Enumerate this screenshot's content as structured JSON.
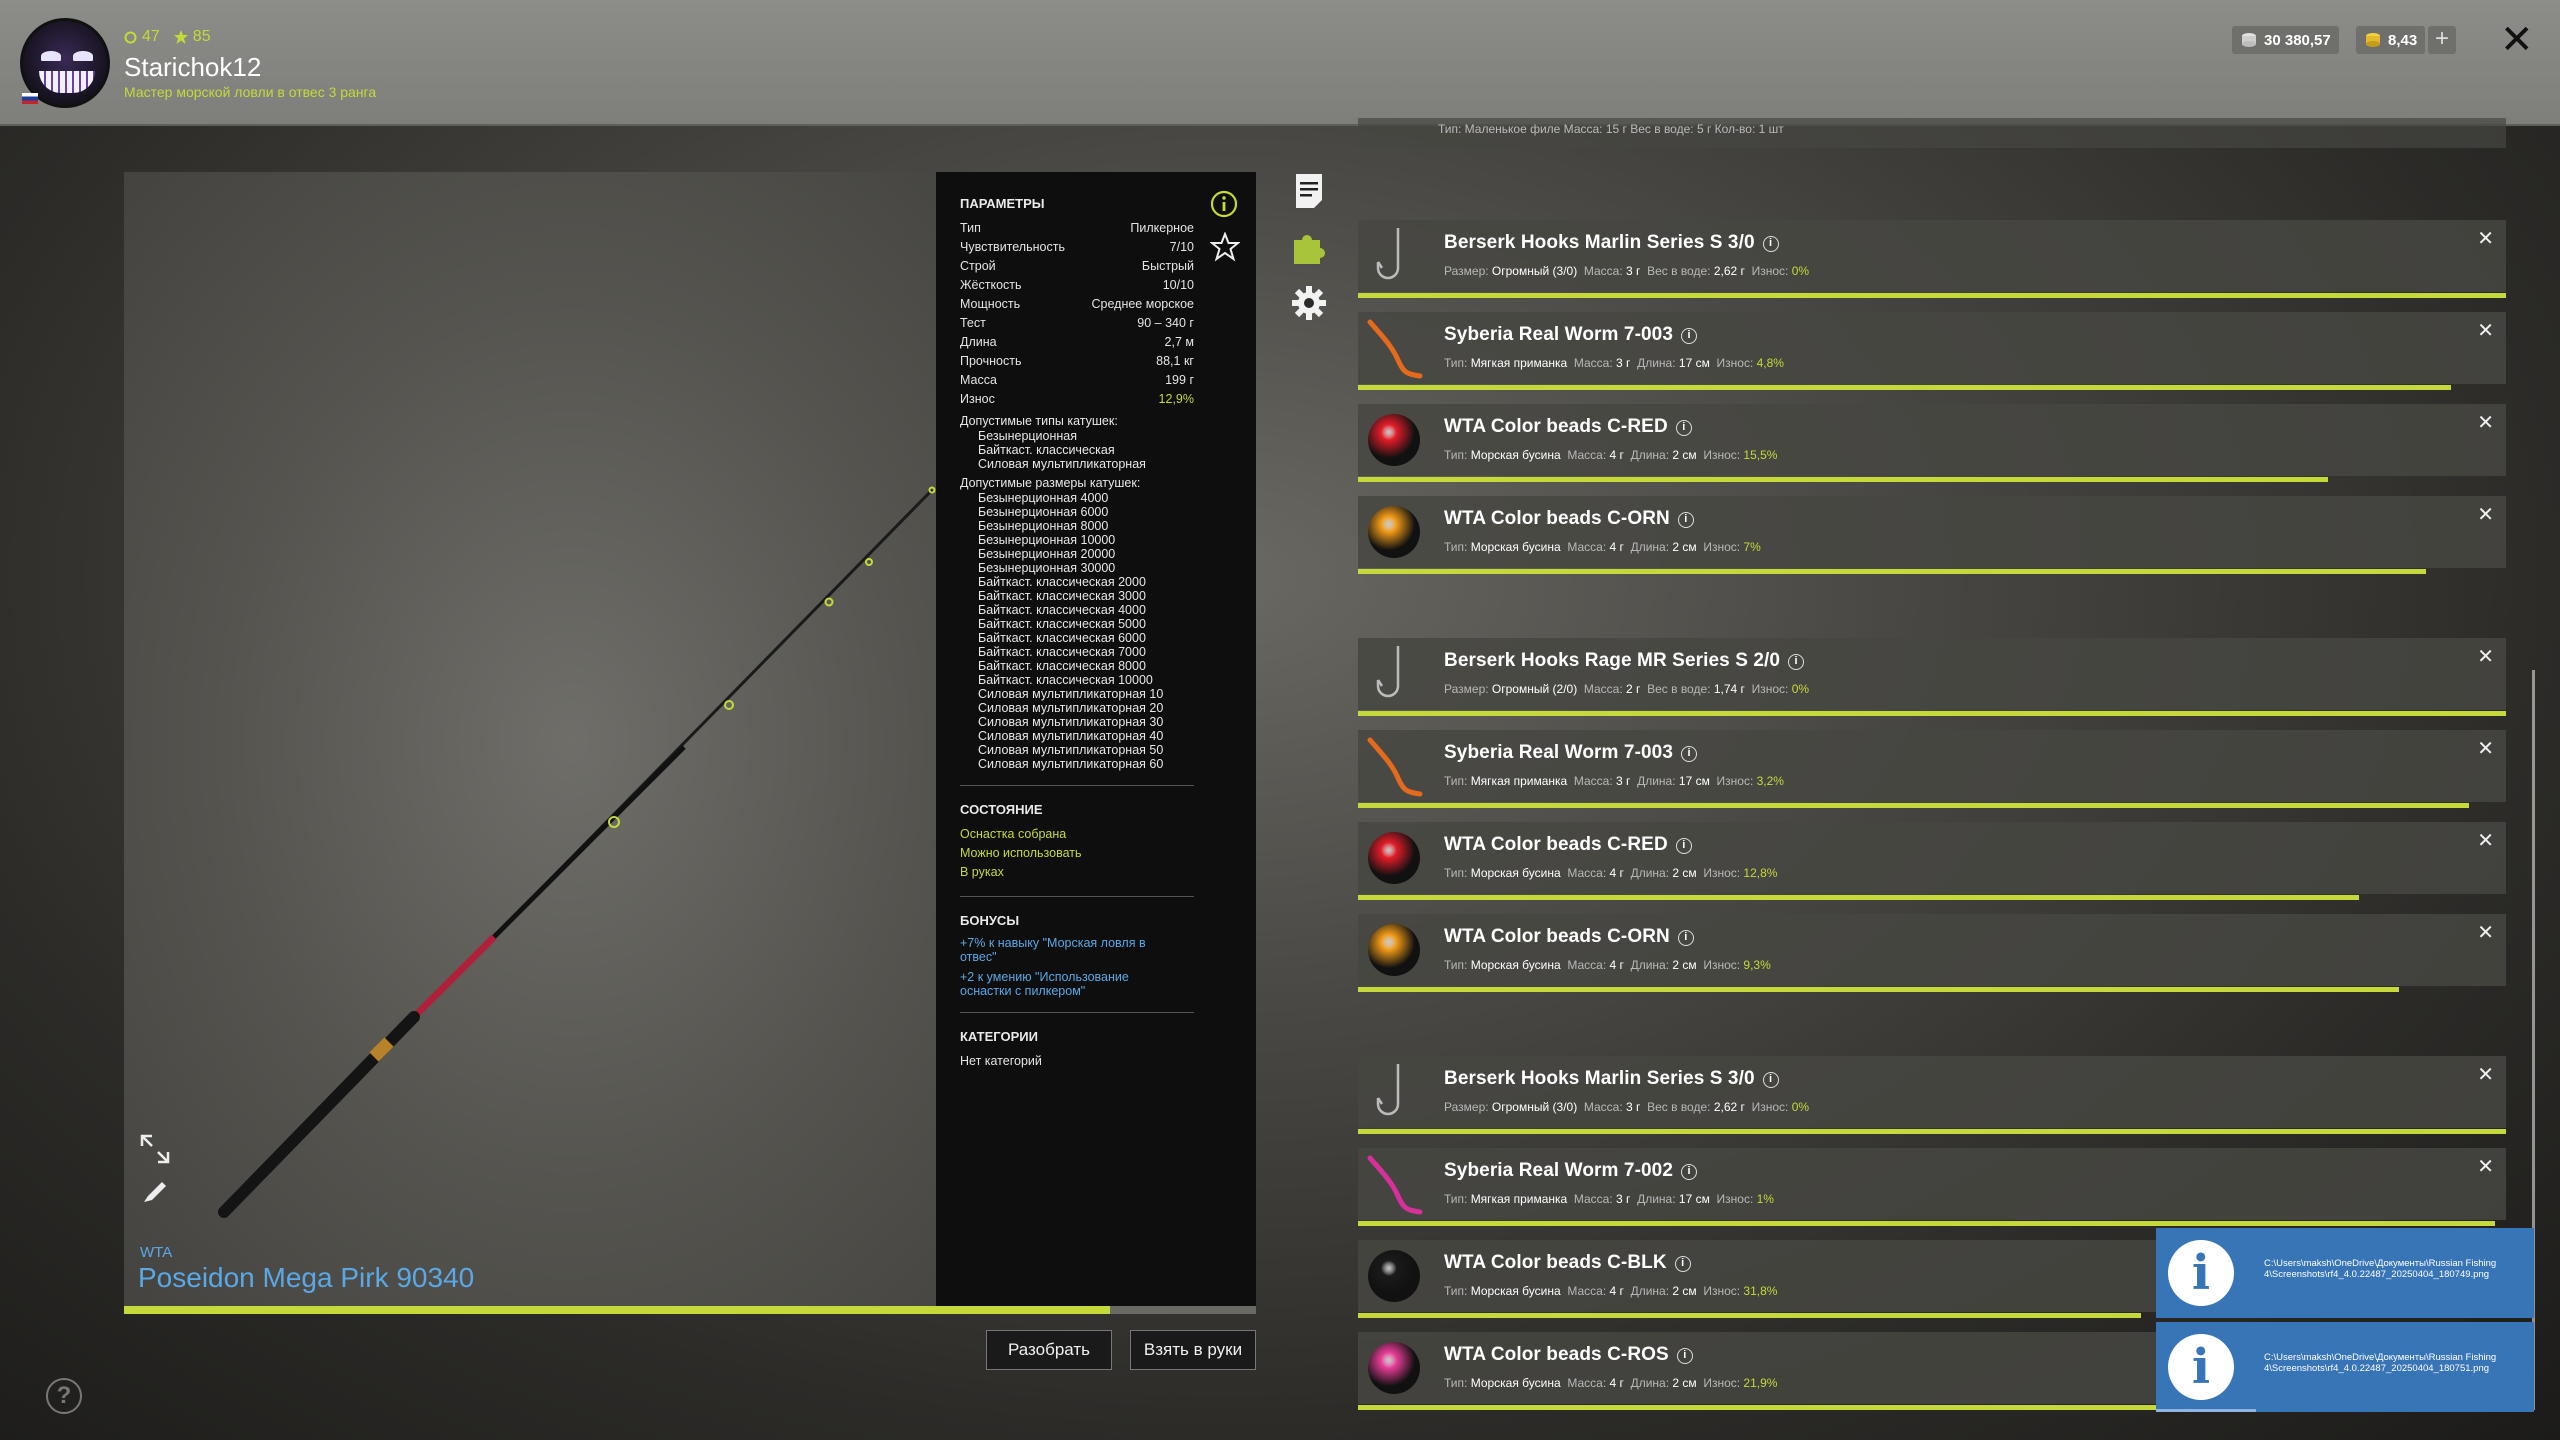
{
  "player": {
    "level": "47",
    "stars": "85",
    "name": "Starichok12",
    "rank": "Мастер морской ловли в отвес 3 ранга",
    "silver": "30 380,57",
    "gold": "8,43"
  },
  "rod": {
    "brand": "WTA",
    "name": "Poseidon Mega Pirk 90340",
    "wear_fraction": 0.871
  },
  "params": {
    "title": "ПАРАМЕТРЫ",
    "rows": [
      {
        "label": "Тип",
        "value": "Пилкерное"
      },
      {
        "label": "Чувствительность",
        "value": "7/10"
      },
      {
        "label": "Строй",
        "value": "Быстрый"
      },
      {
        "label": "Жёсткость",
        "value": "10/10"
      },
      {
        "label": "Мощность",
        "value": "Среднее морское"
      },
      {
        "label": "Тест",
        "value": "90 – 340 г"
      },
      {
        "label": "Длина",
        "value": "2,7 м"
      },
      {
        "label": "Прочность",
        "value": "88,1 кг"
      },
      {
        "label": "Масса",
        "value": "199 г"
      },
      {
        "label": "Износ",
        "value": "12,9%"
      }
    ],
    "reel_types_title": "Допустимые типы катушек:",
    "reel_types": [
      "Безынерционная",
      "Байткаст. классическая",
      "Силовая мультипликаторная"
    ],
    "reel_sizes_title": "Допустимые размеры катушек:",
    "reel_sizes": [
      "Безынерционная 4000",
      "Безынерционная 6000",
      "Безынерционная 8000",
      "Безынерционная 10000",
      "Безынерционная 20000",
      "Безынерционная 30000",
      "Байткаст. классическая 2000",
      "Байткаст. классическая 3000",
      "Байткаст. классическая 4000",
      "Байткаст. классическая 5000",
      "Байткаст. классическая 6000",
      "Байткаст. классическая 7000",
      "Байткаст. классическая 8000",
      "Байткаст. классическая 10000",
      "Силовая мультипликаторная 10",
      "Силовая мультипликаторная 20",
      "Силовая мультипликаторная 30",
      "Силовая мультипликаторная 40",
      "Силовая мультипликаторная 50",
      "Силовая мультипликаторная 60"
    ],
    "state_title": "СОСТОЯНИЕ",
    "states": [
      "Оснастка собрана",
      "Можно использовать",
      "В руках"
    ],
    "bonus_title": "БОНУСЫ",
    "bonuses": [
      "+7% к навыку \"Морская ловля в отвес\"",
      "+2 к умению \"Использование оснастки с пилкером\""
    ],
    "categories_title": "КАТЕГОРИИ",
    "categories": "Нет категорий"
  },
  "buttons": {
    "disassemble": "Разобрать",
    "take": "Взять в руки"
  },
  "ghost_item_text": "Тип: Маленькое филе  Масса: 15 г  Вес в воде: 5 г  Кол-во: 1 шт",
  "items": [
    {
      "name": "Berserk Hooks Marlin Series S 3/0",
      "kind": "hook",
      "details": [
        [
          "Размер:",
          "Огромный (3/0)"
        ],
        [
          "Масса:",
          "3 г"
        ],
        [
          "Вес в воде:",
          "2,62 г"
        ]
      ],
      "wear": "0%",
      "condition": 1.0
    },
    {
      "name": "Syberia Real Worm 7-003",
      "kind": "worm-orange",
      "details": [
        [
          "Тип:",
          "Мягкая приманка"
        ],
        [
          "Масса:",
          "3 г"
        ],
        [
          "Длина:",
          "17 см"
        ]
      ],
      "wear": "4,8%",
      "condition": 0.952
    },
    {
      "name": "WTA Color beads C-RED",
      "kind": "bead-red",
      "details": [
        [
          "Тип:",
          "Морская бусина"
        ],
        [
          "Масса:",
          "4 г"
        ],
        [
          "Длина:",
          "2 см"
        ]
      ],
      "wear": "15,5%",
      "condition": 0.845
    },
    {
      "name": "WTA Color beads C-ORN",
      "kind": "bead-orange",
      "details": [
        [
          "Тип:",
          "Морская бусина"
        ],
        [
          "Масса:",
          "4 г"
        ],
        [
          "Длина:",
          "2 см"
        ]
      ],
      "wear": "7%",
      "condition": 0.93
    },
    {
      "name": "Berserk Hooks Rage MR Series S 2/0",
      "kind": "hook2",
      "details": [
        [
          "Размер:",
          "Огромный (2/0)"
        ],
        [
          "Масса:",
          "2 г"
        ],
        [
          "Вес в воде:",
          "1,74 г"
        ]
      ],
      "wear": "0%",
      "condition": 1.0
    },
    {
      "name": "Syberia Real Worm 7-003",
      "kind": "worm-orange",
      "details": [
        [
          "Тип:",
          "Мягкая приманка"
        ],
        [
          "Масса:",
          "3 г"
        ],
        [
          "Длина:",
          "17 см"
        ]
      ],
      "wear": "3,2%",
      "condition": 0.968
    },
    {
      "name": "WTA Color beads C-RED",
      "kind": "bead-red",
      "details": [
        [
          "Тип:",
          "Морская бусина"
        ],
        [
          "Масса:",
          "4 г"
        ],
        [
          "Длина:",
          "2 см"
        ]
      ],
      "wear": "12,8%",
      "condition": 0.872
    },
    {
      "name": "WTA Color beads C-ORN",
      "kind": "bead-orange",
      "details": [
        [
          "Тип:",
          "Морская бусина"
        ],
        [
          "Масса:",
          "4 г"
        ],
        [
          "Длина:",
          "2 см"
        ]
      ],
      "wear": "9,3%",
      "condition": 0.907
    },
    {
      "name": "Berserk Hooks Marlin Series S 3/0",
      "kind": "hook",
      "details": [
        [
          "Размер:",
          "Огромный (3/0)"
        ],
        [
          "Масса:",
          "3 г"
        ],
        [
          "Вес в воде:",
          "2,62 г"
        ]
      ],
      "wear": "0%",
      "condition": 1.0
    },
    {
      "name": "Syberia Real Worm 7-002",
      "kind": "worm-pink",
      "details": [
        [
          "Тип:",
          "Мягкая приманка"
        ],
        [
          "Масса:",
          "3 г"
        ],
        [
          "Длина:",
          "17 см"
        ]
      ],
      "wear": "1%",
      "condition": 0.99
    },
    {
      "name": "WTA Color beads C-BLK",
      "kind": "bead-black",
      "details": [
        [
          "Тип:",
          "Морская бусина"
        ],
        [
          "Масса:",
          "4 г"
        ],
        [
          "Длина:",
          "2 см"
        ]
      ],
      "wear": "31,8%",
      "condition": 0.682
    },
    {
      "name": "WTA Color beads C-ROS",
      "kind": "bead-pink",
      "details": [
        [
          "Тип:",
          "Морская бусина"
        ],
        [
          "Масса:",
          "4 г"
        ],
        [
          "Длина:",
          "2 см"
        ]
      ],
      "wear": "21,9%",
      "condition": 0.781
    }
  ],
  "notifications": [
    {
      "text": "C:\\Users\\maksh\\OneDrive\\Документы\\Russian Fishing 4\\Screenshots\\rf4_4.0.22487_20250404_180749.png"
    },
    {
      "text": "C:\\Users\\maksh\\OneDrive\\Документы\\Russian Fishing 4\\Screenshots\\rf4_4.0.22487_20250404_180751.png"
    }
  ],
  "colors": {
    "accent": "#c6d93a",
    "link": "#5aa8e6",
    "notification": "#3875b7"
  },
  "labels": {
    "wear": "Износ:",
    "help": "?"
  }
}
